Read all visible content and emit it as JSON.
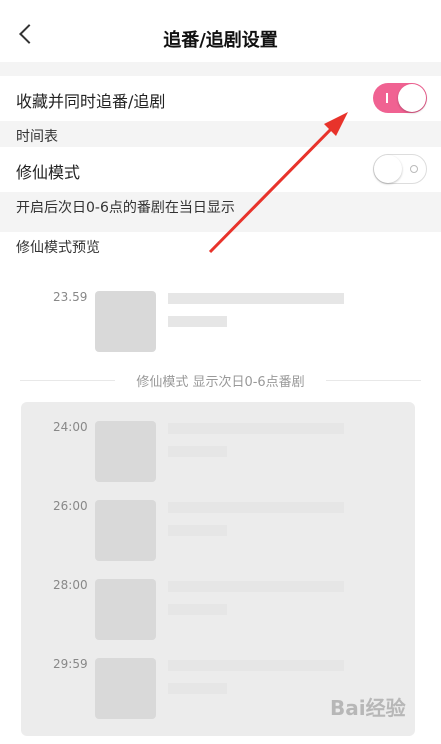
{
  "header": {
    "title": "追番/追剧设置"
  },
  "settings": {
    "collect_follow": {
      "label": "收藏并同时追番/追剧",
      "enabled": true
    },
    "schedule_section": "时间表",
    "xiuxian_mode": {
      "label": "修仙模式",
      "enabled": false
    },
    "xiuxian_desc": "开启后次日0-6点的番剧在当日显示",
    "preview_section": "修仙模式预览"
  },
  "preview": {
    "normal_times": [
      "23.59"
    ],
    "divider_text": "修仙模式 显示次日0-6点番剧",
    "xiuxian_times": [
      "24:00",
      "26:00",
      "28:00",
      "29:59"
    ]
  },
  "watermark": "Bai经验",
  "colors": {
    "toggle_on": "#f06292",
    "arrow": "#e8332b"
  }
}
